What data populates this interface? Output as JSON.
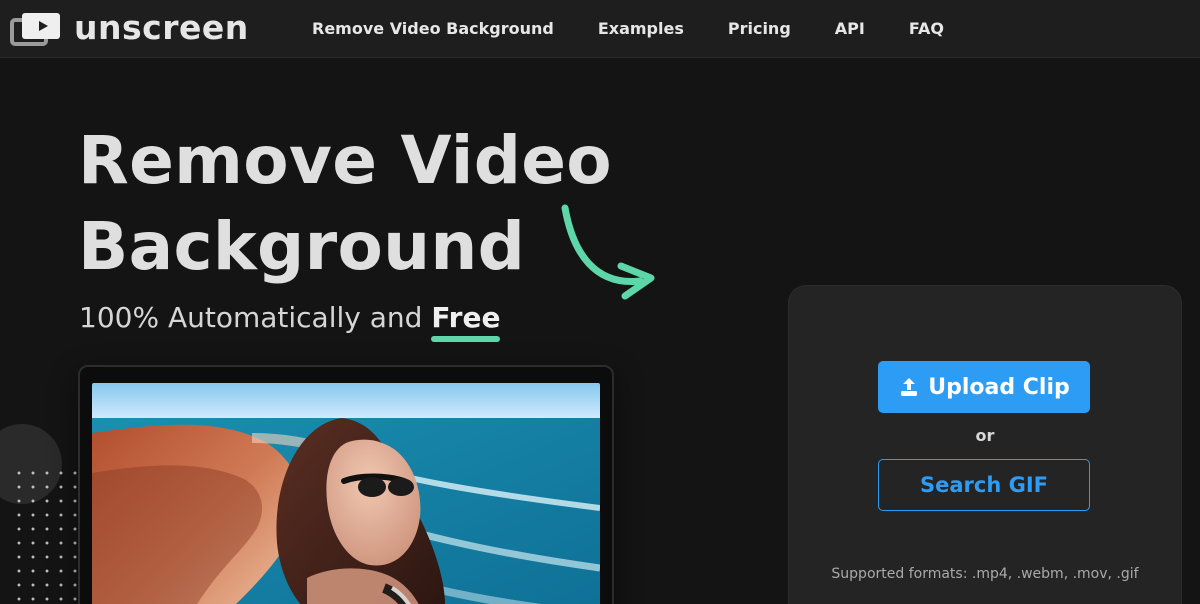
{
  "nav": {
    "brand": "unscreen",
    "links": [
      "Remove Video Background",
      "Examples",
      "Pricing",
      "API",
      "FAQ"
    ]
  },
  "hero": {
    "title_line1": "Remove Video",
    "title_line2": "Background",
    "subtitle_prefix": "100% Automatically and ",
    "subtitle_emphasis": "Free"
  },
  "panel": {
    "upload_label": "Upload Clip",
    "or_label": "or",
    "search_label": "Search GIF",
    "supported_formats": "Supported formats: .mp4, .webm, .mov, .gif"
  },
  "colors": {
    "accent_blue": "#2d9cf5",
    "accent_green": "#5dd6aa",
    "background": "#141414",
    "nav_background": "#1e1e1e",
    "panel_background": "#242424"
  },
  "icons": {
    "brand_icon": "video-stack-icon",
    "arrow_icon": "curved-arrow-icon",
    "upload_icon": "upload-icon"
  }
}
